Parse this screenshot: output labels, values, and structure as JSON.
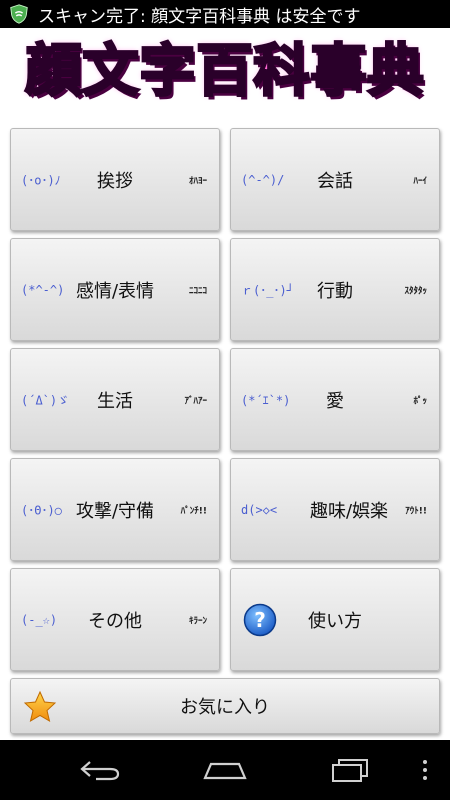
{
  "status_bar": {
    "notification": "スキャン完了: 顔文字百科事典 は安全です",
    "icon": "shield-icon"
  },
  "banner": {
    "title": "顔文字百科事典"
  },
  "tiles": [
    {
      "emoticon": "(･o･)ﾉ",
      "label": "挨拶",
      "sound": "ｵﾊﾖｰ"
    },
    {
      "emoticon": "(^-^)/",
      "label": "会話",
      "sound": "ﾊｰｲ"
    },
    {
      "emoticon": "(*^-^)",
      "label": "感情/表情",
      "sound": "ﾆｺﾆｺ"
    },
    {
      "emoticon": "ｒ(･_･)┘",
      "label": "行動",
      "sound": "ｽﾀﾀﾀｯ"
    },
    {
      "emoticon": "(´Δ`)ゞ",
      "label": "生活",
      "sound": "ｱﾞﾊｱｰ"
    },
    {
      "emoticon": "(*´ｴ`*)",
      "label": "愛",
      "sound": "ﾎﾟｯ"
    },
    {
      "emoticon": "(･Θ･)○",
      "label": "攻撃/守備",
      "sound": "ﾊﾟﾝﾁ!!"
    },
    {
      "emoticon": "d(>◇<",
      "label": "趣味/娯楽",
      "sound": "ｱｳﾄ!!"
    },
    {
      "emoticon": "(-_☆)",
      "label": "その他",
      "sound": "ｷﾗｰﾝ"
    }
  ],
  "help_tile": {
    "label": "使い方",
    "icon": "question-icon"
  },
  "favorites": {
    "label": "お気に入り",
    "icon": "star-icon"
  },
  "colors": {
    "banner_pink": "#ff66d4",
    "emoticon_blue": "#4a5ed0",
    "help_blue": "#2f7fe0",
    "star_orange": "#f5a623"
  }
}
